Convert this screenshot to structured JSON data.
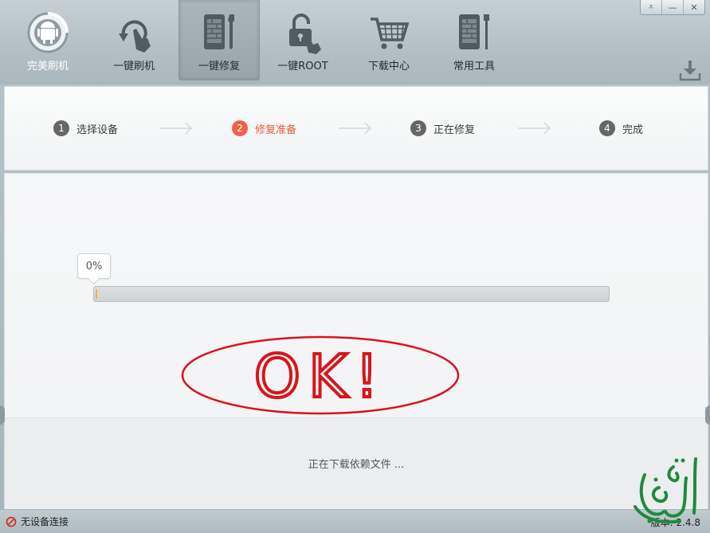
{
  "toolbar": {
    "items": [
      {
        "label": "完美刷机",
        "icon": "android-gear-icon",
        "active": false
      },
      {
        "label": "一键刷机",
        "icon": "refresh-hand-icon",
        "active": false
      },
      {
        "label": "一键修复",
        "icon": "phone-wrench-icon",
        "active": true
      },
      {
        "label": "一键ROOT",
        "icon": "unlock-hand-icon",
        "active": false
      },
      {
        "label": "下载中心",
        "icon": "shopping-cart-icon",
        "active": false
      },
      {
        "label": "常用工具",
        "icon": "phone-tool-icon",
        "active": false
      }
    ]
  },
  "window_controls": {
    "menu": "⩡",
    "minimize": "—",
    "close": "✕"
  },
  "steps": [
    {
      "num": "1",
      "label": "选择设备",
      "state": "normal"
    },
    {
      "num": "2",
      "label": "修复准备",
      "state": "active"
    },
    {
      "num": "3",
      "label": "正在修复",
      "state": "normal"
    },
    {
      "num": "4",
      "label": "完成",
      "state": "normal"
    }
  ],
  "progress": {
    "label": "0%",
    "value": 0
  },
  "annotation": {
    "text": "OK!",
    "color": "#d9141a"
  },
  "status": {
    "message": "正在下载依赖文件 ..."
  },
  "statusbar": {
    "device": "无设备连接",
    "version": "版本: 2.4.8"
  },
  "colors": {
    "accent": "#ed6246",
    "annotation": "#d9141a",
    "watermark": "#1f8a3d"
  }
}
